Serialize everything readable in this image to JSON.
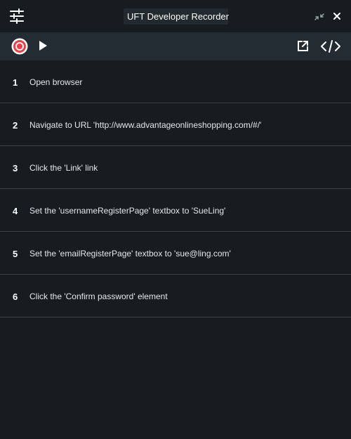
{
  "window": {
    "title": "UFT Developer Recorder"
  },
  "toolbar": {
    "icons": [
      "settings-icon",
      "record-icon",
      "play-icon",
      "export-icon",
      "code-icon",
      "minimize-icon",
      "close-icon"
    ],
    "record_color": "#e8434b"
  },
  "steps": [
    {
      "num": "1",
      "text": "Open browser"
    },
    {
      "num": "2",
      "text": "Navigate to URL 'http://www.advantageonlineshopping.com/#/'"
    },
    {
      "num": "3",
      "text": "Click the 'Link' link"
    },
    {
      "num": "4",
      "text": "Set the 'usernameRegisterPage' textbox to 'SueLing'"
    },
    {
      "num": "5",
      "text": "Set the 'emailRegisterPage' textbox to 'sue@ling.com'"
    },
    {
      "num": "6",
      "text": "Click the 'Confirm password' element"
    }
  ]
}
